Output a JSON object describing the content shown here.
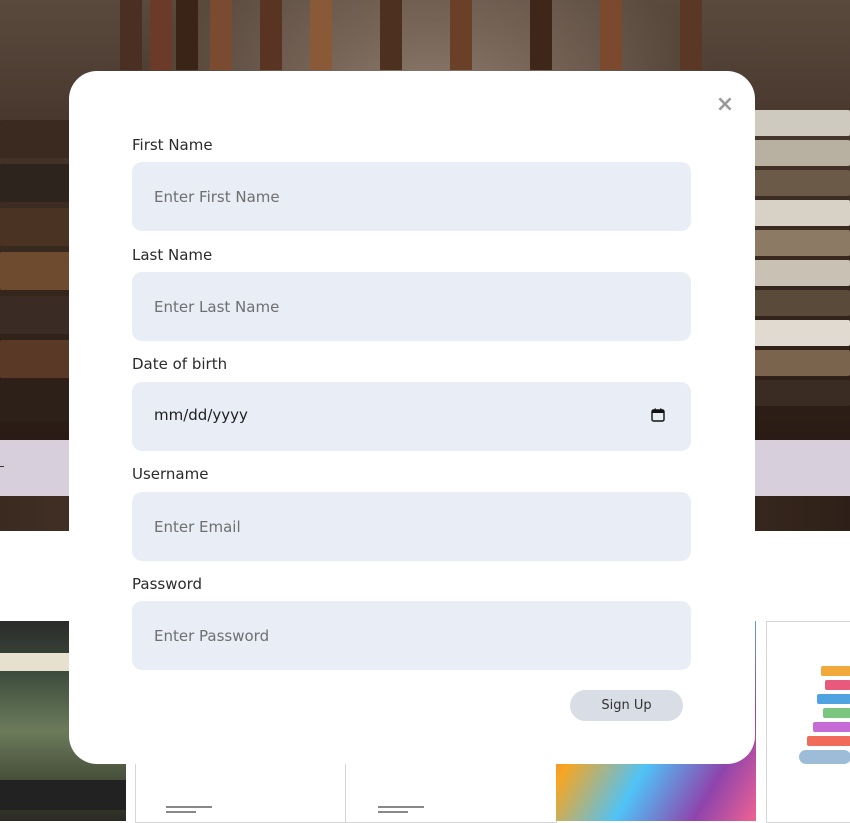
{
  "modal": {
    "close_symbol": "×",
    "fields": {
      "first_name": {
        "label": "First Name",
        "placeholder": "Enter First Name"
      },
      "last_name": {
        "label": "Last Name",
        "placeholder": "Enter Last Name"
      },
      "dob": {
        "label": "Date of birth",
        "value": "mm/dd/yyyy"
      },
      "username": {
        "label": "Username",
        "placeholder": "Enter Email"
      },
      "password": {
        "label": "Password",
        "placeholder": "Enter Password"
      }
    },
    "submit_label": "Sign Up"
  },
  "icons": {
    "close": "close-icon",
    "calendar": "calendar-icon"
  },
  "colors": {
    "input_bg": "#e9edf5",
    "button_bg": "#d9dde6",
    "band": "#d8cfdc"
  }
}
